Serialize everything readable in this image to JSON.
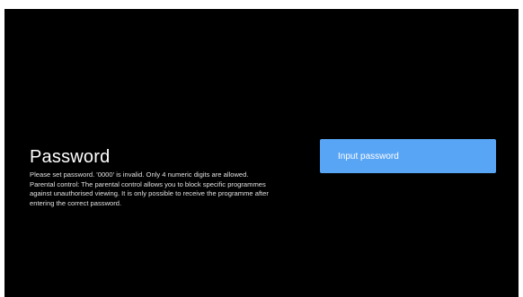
{
  "dialog": {
    "title": "Password",
    "lines": [
      "Please set password. '0000' is invalid. Only 4 numeric digits are allowed.",
      "Parental control: The parental control allows you to block specific programmes",
      "against unauthorised viewing. It is only possible to receive the programme after",
      "entering the correct password."
    ]
  },
  "input_button": {
    "label": "Input password"
  },
  "colors": {
    "background": "#000000",
    "accent": "#59a5f5",
    "text": "#ffffff"
  }
}
